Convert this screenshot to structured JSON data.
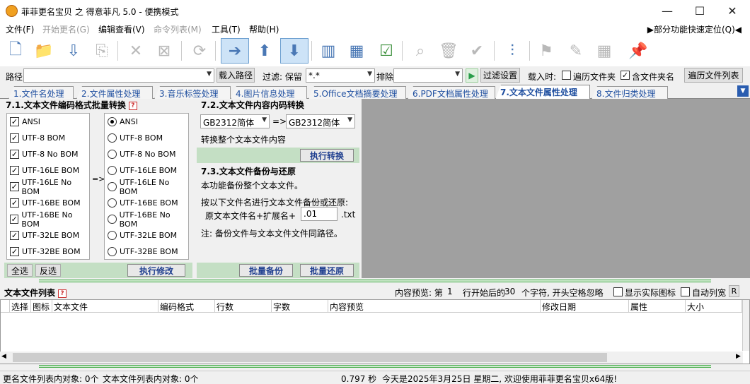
{
  "window": {
    "title": "菲菲更名宝贝 之 得意菲凡 5.0 - 便携模式",
    "minimize": "—",
    "maximize": "☐",
    "close": "✕"
  },
  "menu": {
    "items": [
      {
        "label": "文件(F)",
        "enabled": true
      },
      {
        "label": "开始更名(G)",
        "enabled": false
      },
      {
        "label": "编辑查看(V)",
        "enabled": true
      },
      {
        "label": "命令列表(M)",
        "enabled": false
      },
      {
        "label": "工具(T)",
        "enabled": true
      },
      {
        "label": "帮助(H)",
        "enabled": true
      }
    ],
    "quick_access": "▶部分功能快速定位(Q)◀"
  },
  "path_bar": {
    "path_label": "路径",
    "path_value": "",
    "load_button": "载入路径",
    "filter_label": "过滤: 保留",
    "filter_value": "*.*",
    "exclude_label": "排除",
    "exclude_value": "",
    "filter_settings_button": "过滤设置",
    "load_when_label": "载入时:",
    "traverse_folders_label": "遍历文件夹",
    "traverse_folders_checked": false,
    "include_folder_names_label": "含文件夹名",
    "include_folder_names_checked": true,
    "traverse_list_button": "遍历文件列表"
  },
  "tabs": [
    {
      "label": "1.文件名处理",
      "active": false
    },
    {
      "label": "2.文件属性处理",
      "active": false
    },
    {
      "label": "3.音乐标签处理",
      "active": false
    },
    {
      "label": "4.图片信息处理",
      "active": false
    },
    {
      "label": "5.Office文档摘要处理",
      "active": false
    },
    {
      "label": "6.PDF文档属性处理",
      "active": false
    },
    {
      "label": "7.文本文件属性处理",
      "active": true
    },
    {
      "label": "8.文件归类处理",
      "active": false
    }
  ],
  "encoding_panel": {
    "title": "7.1.文本文件编码格式批量转换",
    "help": "?",
    "arrow": "=>",
    "source_encodings": [
      {
        "label": "ANSI",
        "checked": true
      },
      {
        "label": "UTF-8 BOM",
        "checked": true
      },
      {
        "label": "UTF-8 No BOM",
        "checked": true
      },
      {
        "label": "UTF-16LE BOM",
        "checked": true
      },
      {
        "label": "UTF-16LE No BOM",
        "checked": true
      },
      {
        "label": "UTF-16BE BOM",
        "checked": true
      },
      {
        "label": "UTF-16BE No BOM",
        "checked": true
      },
      {
        "label": "UTF-32LE BOM",
        "checked": true
      },
      {
        "label": "UTF-32BE BOM",
        "checked": true
      }
    ],
    "target_encodings": [
      {
        "label": "ANSI",
        "selected": true
      },
      {
        "label": "UTF-8 BOM",
        "selected": false
      },
      {
        "label": "UTF-8 No BOM",
        "selected": false
      },
      {
        "label": "UTF-16LE BOM",
        "selected": false
      },
      {
        "label": "UTF-16LE No BOM",
        "selected": false
      },
      {
        "label": "UTF-16BE BOM",
        "selected": false
      },
      {
        "label": "UTF-16BE No BOM",
        "selected": false
      },
      {
        "label": "UTF-32LE BOM",
        "selected": false
      },
      {
        "label": "UTF-32BE BOM",
        "selected": false
      }
    ],
    "select_all": "全选",
    "invert": "反选",
    "execute": "执行修改"
  },
  "convert_panel": {
    "title": "7.2.文本文件内容内码转换",
    "from": "GB2312简体",
    "arrow": "=>",
    "to": "GB2312简体",
    "desc": "转换整个文本文件内容",
    "execute": "执行转换"
  },
  "backup_panel": {
    "title": "7.3.文本文件备份与还原",
    "desc1": "本功能备份整个文本文件。",
    "desc2": "按以下文件名进行文本文件备份或还原:",
    "name_label": "原文本文件名+扩展名+",
    "ext_value": ".01",
    "ext_suffix": ".txt",
    "note": "注: 备份文件与文本文件文件同路径。",
    "backup": "批量备份",
    "restore": "批量还原"
  },
  "file_list": {
    "title": "文本文件列表",
    "help": "?",
    "preview_label": "内容预览: 第",
    "preview_start": "1",
    "preview_after": "行开始后的",
    "preview_chars": "30",
    "preview_tail": "个字符, 开头空格忽略",
    "show_icons_label": "显示实际图标",
    "show_icons_checked": false,
    "auto_width_label": "自动列宽",
    "auto_width_checked": false,
    "r_button": "R",
    "columns": [
      "选择",
      "图标",
      "文本文件",
      "编码格式",
      "行数",
      "字数",
      "内容预览",
      "修改日期",
      "属性",
      "大小"
    ]
  },
  "status": {
    "rename_list": "更名文件列表内对象: 0个",
    "text_list": "文本文件列表内对象: 0个",
    "time": "0.797 秒",
    "message": "今天是2025年3月25日 星期二, 欢迎使用菲菲更名宝贝x64版!"
  },
  "colors": {
    "tab_text": "#1f4fa0",
    "action_text": "#1f3f8f",
    "green_bar": "#c4dfc4",
    "gray_area": "#a0a0a0"
  }
}
